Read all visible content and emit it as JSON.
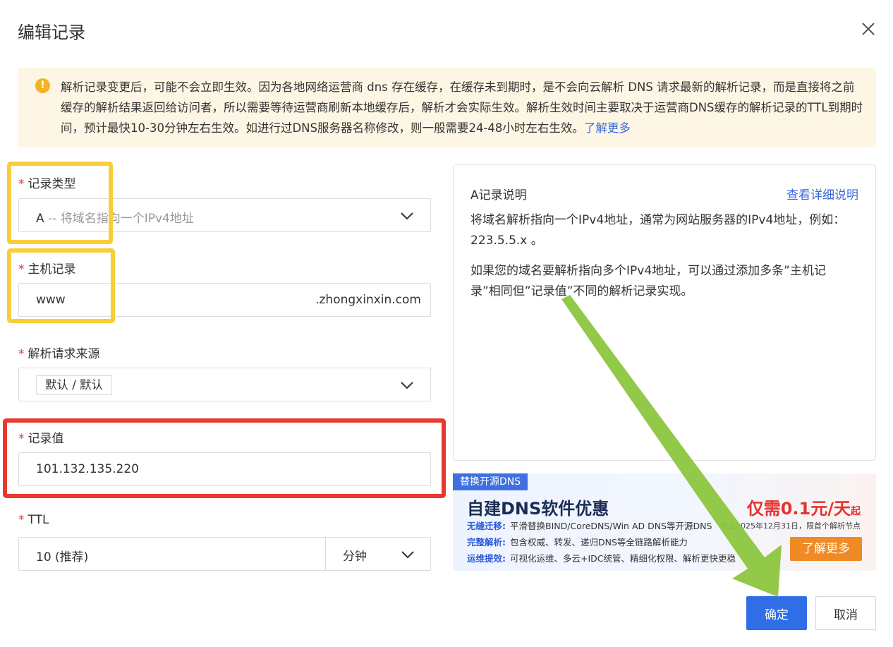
{
  "dialog": {
    "title": "编辑记录",
    "close_icon": "close-icon"
  },
  "notice": {
    "icon": "warning-icon",
    "text": "解析记录变更后，可能不会立即生效。因为各地网络运营商 dns 存在缓存，在缓存未到期时，是不会向云解析 DNS 请求最新的解析记录，而是直接将之前缓存的解析结果返回给访问者，所以需要等待运营商刷新本地缓存后，解析才会实际生效。解析生效时间主要取决于运营商DNS缓存的解析记录的TTL到期时间，预计最快10-30分钟左右生效。如进行过DNS服务器名称修改，则一般需要24-48小时左右生效。",
    "link": "了解更多"
  },
  "form": {
    "record_type": {
      "label": "记录类型",
      "value_code": "A",
      "value_desc": " -- 将域名指向一个IPv4地址"
    },
    "host": {
      "label": "主机记录",
      "value": "www",
      "suffix": ".zhongxinxin.com"
    },
    "source": {
      "label": "解析请求来源",
      "value": "默认 / 默认"
    },
    "record_value": {
      "label": "记录值",
      "value": "101.132.135.220"
    },
    "ttl": {
      "label": "TTL",
      "value": "10 (推荐)",
      "unit": "分钟"
    }
  },
  "help_panel": {
    "title": "A记录说明",
    "link": "查看详细说明",
    "paragraph1": "将域名解析指向一个IPv4地址，通常为网站服务器的IPv4地址，例如：223.5.5.x 。",
    "paragraph2": "如果您的域名要解析指向多个IPv4地址，可以通过添加多条”主机记录”相同但”记录值”不同的解析记录实现。"
  },
  "banner": {
    "tag": "替换开源DNS",
    "headline": "自建DNS软件优惠",
    "lines": [
      {
        "key": "无缝迁移:",
        "text": "平滑替换BIND/CoreDNS/Win AD DNS等开源DNS"
      },
      {
        "key": "完整解析:",
        "text": "包含权威、转发、递归DNS等全链路解析能力"
      },
      {
        "key": "运维提效:",
        "text": "可视化运维、多云+IDC统管、精细化权限、解析更快更稳"
      }
    ],
    "price": "仅需0.1元/天",
    "price_suffix": "起",
    "deadline": "截止2025年12月31日，限首个解析节点",
    "cta": "了解更多"
  },
  "footer": {
    "ok": "确定",
    "cancel": "取消"
  },
  "colors": {
    "primary": "#2f6ee6",
    "highlight_yellow": "#f9cd3a",
    "highlight_red": "#e9382f",
    "arrow_green": "#8cc63f"
  }
}
